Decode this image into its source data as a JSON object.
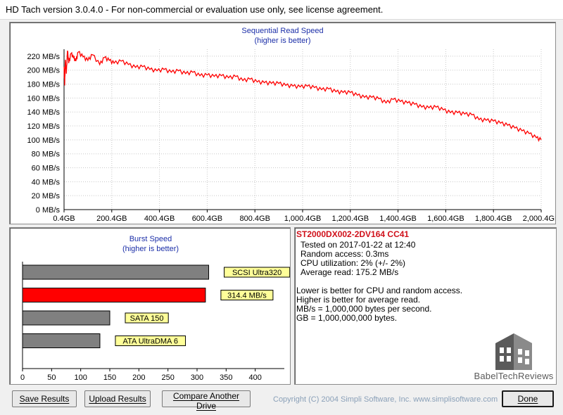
{
  "window": {
    "title": "HD Tach version 3.0.4.0  - For non-commercial or evaluation use only, see license agreement."
  },
  "seq_chart": {
    "title": "Sequential Read Speed",
    "subtitle": "(higher is better)"
  },
  "burst_chart": {
    "title": "Burst Speed",
    "subtitle": "(higher is better)"
  },
  "chart_data": [
    {
      "type": "line",
      "title": "Sequential Read Speed",
      "subtitle": "(higher is better)",
      "ylim": [
        0,
        230
      ],
      "xlim": [
        0.4,
        2000.4
      ],
      "y_ticks": [
        "0 MB/s",
        "20 MB/s",
        "40 MB/s",
        "60 MB/s",
        "80 MB/s",
        "100 MB/s",
        "120 MB/s",
        "140 MB/s",
        "160 MB/s",
        "180 MB/s",
        "200 MB/s",
        "220 MB/s"
      ],
      "y_tick_values": [
        0,
        20,
        40,
        60,
        80,
        100,
        120,
        140,
        160,
        180,
        200,
        220
      ],
      "x_ticks": [
        "0.4GB",
        "200.4GB",
        "400.4GB",
        "600.4GB",
        "800.4GB",
        "1,000.4GB",
        "1,200.4GB",
        "1,400.4GB",
        "1,600.4GB",
        "1,800.4GB",
        "2,000.4GB"
      ],
      "x_tick_values": [
        0.4,
        200.4,
        400.4,
        600.4,
        800.4,
        1000.4,
        1200.4,
        1400.4,
        1600.4,
        1800.4,
        2000.4
      ],
      "grid": true,
      "color": "#ff0000",
      "series": [
        {
          "x": [
            0.4,
            3,
            6,
            10,
            15,
            20,
            30,
            40,
            50,
            60,
            80,
            100,
            120,
            150,
            170,
            190,
            210,
            240,
            270,
            300,
            330,
            360,
            390,
            420,
            450,
            480,
            510,
            540,
            570,
            600,
            630,
            660,
            690,
            720,
            750,
            780,
            810,
            840,
            870,
            900,
            930,
            960,
            990,
            1020,
            1050,
            1080,
            1110,
            1140,
            1170,
            1200,
            1230,
            1260,
            1290,
            1320,
            1350,
            1380,
            1410,
            1440,
            1470,
            1500,
            1530,
            1560,
            1590,
            1620,
            1650,
            1680,
            1710,
            1740,
            1770,
            1800,
            1830,
            1860,
            1890,
            1920,
            1950,
            1980,
            2000.4
          ],
          "y": [
            205,
            178,
            215,
            195,
            228,
            210,
            224,
            218,
            213,
            226,
            219,
            214,
            222,
            208,
            218,
            214,
            210,
            213,
            208,
            204,
            205,
            201,
            199,
            201,
            197,
            199,
            195,
            197,
            192,
            193,
            191,
            192,
            189,
            191,
            185,
            187,
            183,
            182,
            181,
            181,
            178,
            177,
            176,
            177,
            175,
            172,
            173,
            169,
            168,
            168,
            164,
            161,
            161,
            159,
            153,
            158,
            155,
            153,
            151,
            147,
            146,
            147,
            143,
            139,
            139,
            137,
            136,
            129,
            128,
            127,
            124,
            121,
            117,
            113,
            109,
            103,
            100
          ]
        }
      ]
    },
    {
      "type": "bar",
      "orientation": "horizontal",
      "title": "Burst Speed",
      "subtitle": "(higher is better)",
      "xlim": [
        0,
        450
      ],
      "x_ticks": [
        "0",
        "50",
        "100",
        "150",
        "200",
        "250",
        "300",
        "350",
        "400"
      ],
      "x_tick_values": [
        0,
        50,
        100,
        150,
        200,
        250,
        300,
        350,
        400
      ],
      "categories": [
        "SCSI Ultra320",
        "314.4 MB/s",
        "SATA 150",
        "ATA UltraDMA 6"
      ],
      "values": [
        320,
        314.4,
        150,
        133
      ],
      "colors": [
        "#808080",
        "#ff0000",
        "#808080",
        "#808080"
      ]
    }
  ],
  "drive_info": {
    "model": "ST2000DX002-2DV164 CC41",
    "tested": "Tested on 2017-01-22 at 12:40",
    "random_access": "Random access: 0.3ms",
    "cpu": "CPU utilization: 2% (+/- 2%)",
    "avg_read": "Average read: 175.2 MB/s",
    "note1": "Lower is better for CPU and random access.",
    "note2": "Higher is better for average read.",
    "note3": "MB/s = 1,000,000 bytes per second.",
    "note4": "GB = 1,000,000,000 bytes."
  },
  "logo": {
    "text": "BabelTechReviews"
  },
  "footer": {
    "save_label": "Save Results",
    "upload_label": "Upload Results",
    "compare_label": "Compare Another Drive",
    "copyright": "Copyright (C) 2004 Simpli Software, Inc. www.simplisoftware.com",
    "done_label": "Done"
  }
}
